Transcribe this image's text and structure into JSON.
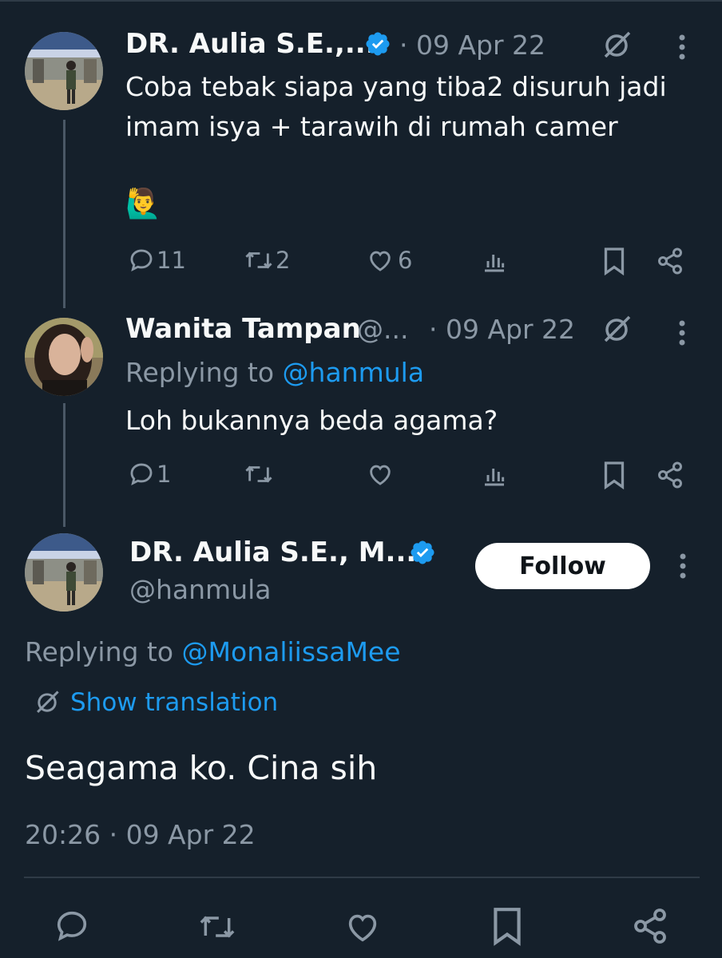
{
  "tweet1": {
    "name": "DR. Aulia S.E.,...",
    "meta": "· 09 Apr 22",
    "text_line1": "Coba tebak siapa yang tiba2 disuruh jadi",
    "text_line2": "imam isya + tarawih di rumah camer",
    "emoji": "🙋‍♂️",
    "reply_count": "11",
    "retweet_count": "2",
    "like_count": "6"
  },
  "tweet2": {
    "name": "Wanita Tampan",
    "handle": "@...",
    "meta": "· 09 Apr 22",
    "replying_prefix": "Replying to ",
    "replying_handle": "@hanmula",
    "text": "Loh bukannya beda agama?",
    "reply_count": "1"
  },
  "main_tweet": {
    "name": "DR. Aulia S.E., M....",
    "handle": "@hanmula",
    "follow_label": "Follow",
    "replying_prefix": "Replying to ",
    "replying_handle": "@MonaliissaMee",
    "show_translation": "Show translation",
    "text": "Seagama ko. Cina sih",
    "timestamp": "20:26 · 09 Apr 22"
  },
  "colors": {
    "background": "#15202b",
    "accent": "#1d9bf0",
    "muted": "#8b98a5",
    "verified": "#1d9bf0"
  },
  "icons": [
    "verified-badge-icon",
    "grok-icon",
    "more-icon",
    "reply-icon",
    "retweet-icon",
    "like-icon",
    "views-icon",
    "bookmark-icon",
    "share-icon",
    "translate-icon"
  ]
}
